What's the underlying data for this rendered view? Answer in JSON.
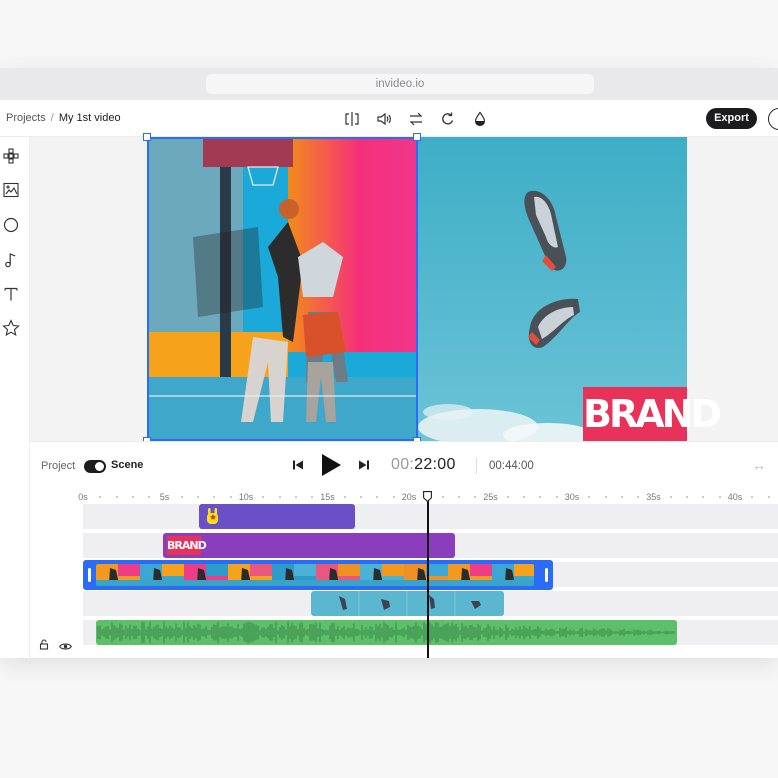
{
  "browser": {
    "url": "invideo.io"
  },
  "header": {
    "breadcrumb_root": "Projects",
    "breadcrumb_sep": "/",
    "breadcrumb_current": "My 1st video",
    "export_label": "Export",
    "tools": [
      "split-icon",
      "volume-icon",
      "swap-icon",
      "rotate-icon",
      "color-drop-icon"
    ]
  },
  "sidebar": {
    "items": [
      "templates-icon",
      "media-icon",
      "stickers-icon",
      "music-icon",
      "text-icon",
      "favorites-icon"
    ]
  },
  "canvas": {
    "brand_text": "BRAND",
    "brand_color": "#e8325a",
    "selection_color": "#2a6cf6"
  },
  "controls": {
    "project_label": "Project",
    "scene_label": "Scene",
    "current_time_dim": "00:",
    "current_time": "22:00",
    "total_time": "00:44:00"
  },
  "timeline": {
    "ruler": [
      "0s",
      "5s",
      "10s",
      "15s",
      "20s",
      "25s",
      "30s",
      "35s",
      "40s"
    ],
    "sticker_clip_color": "#6a4fc9",
    "brand_clip_color": "#8a3dbd",
    "brand_clip_text": "BRAND",
    "audio_clip_color": "#5dbf6a"
  }
}
